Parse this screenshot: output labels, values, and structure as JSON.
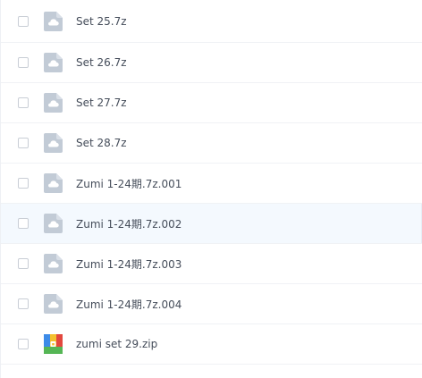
{
  "files": [
    {
      "name": "Set 25.7z",
      "type": "cloud-file-icon"
    },
    {
      "name": "Set 26.7z",
      "type": "cloud-file-icon"
    },
    {
      "name": "Set 27.7z",
      "type": "cloud-file-icon"
    },
    {
      "name": "Set 28.7z",
      "type": "cloud-file-icon"
    },
    {
      "name": "Zumi 1-24期.7z.001",
      "type": "cloud-file-icon"
    },
    {
      "name": "Zumi 1-24期.7z.002",
      "type": "cloud-file-icon"
    },
    {
      "name": "Zumi 1-24期.7z.003",
      "type": "cloud-file-icon"
    },
    {
      "name": "Zumi 1-24期.7z.004",
      "type": "cloud-file-icon"
    },
    {
      "name": "zumi set 29.zip",
      "type": "zip-archive-icon"
    }
  ],
  "colors": {
    "icon_gray": "#c2cbd6",
    "hover_row": "#f4f9fe",
    "text": "#454d5a"
  }
}
